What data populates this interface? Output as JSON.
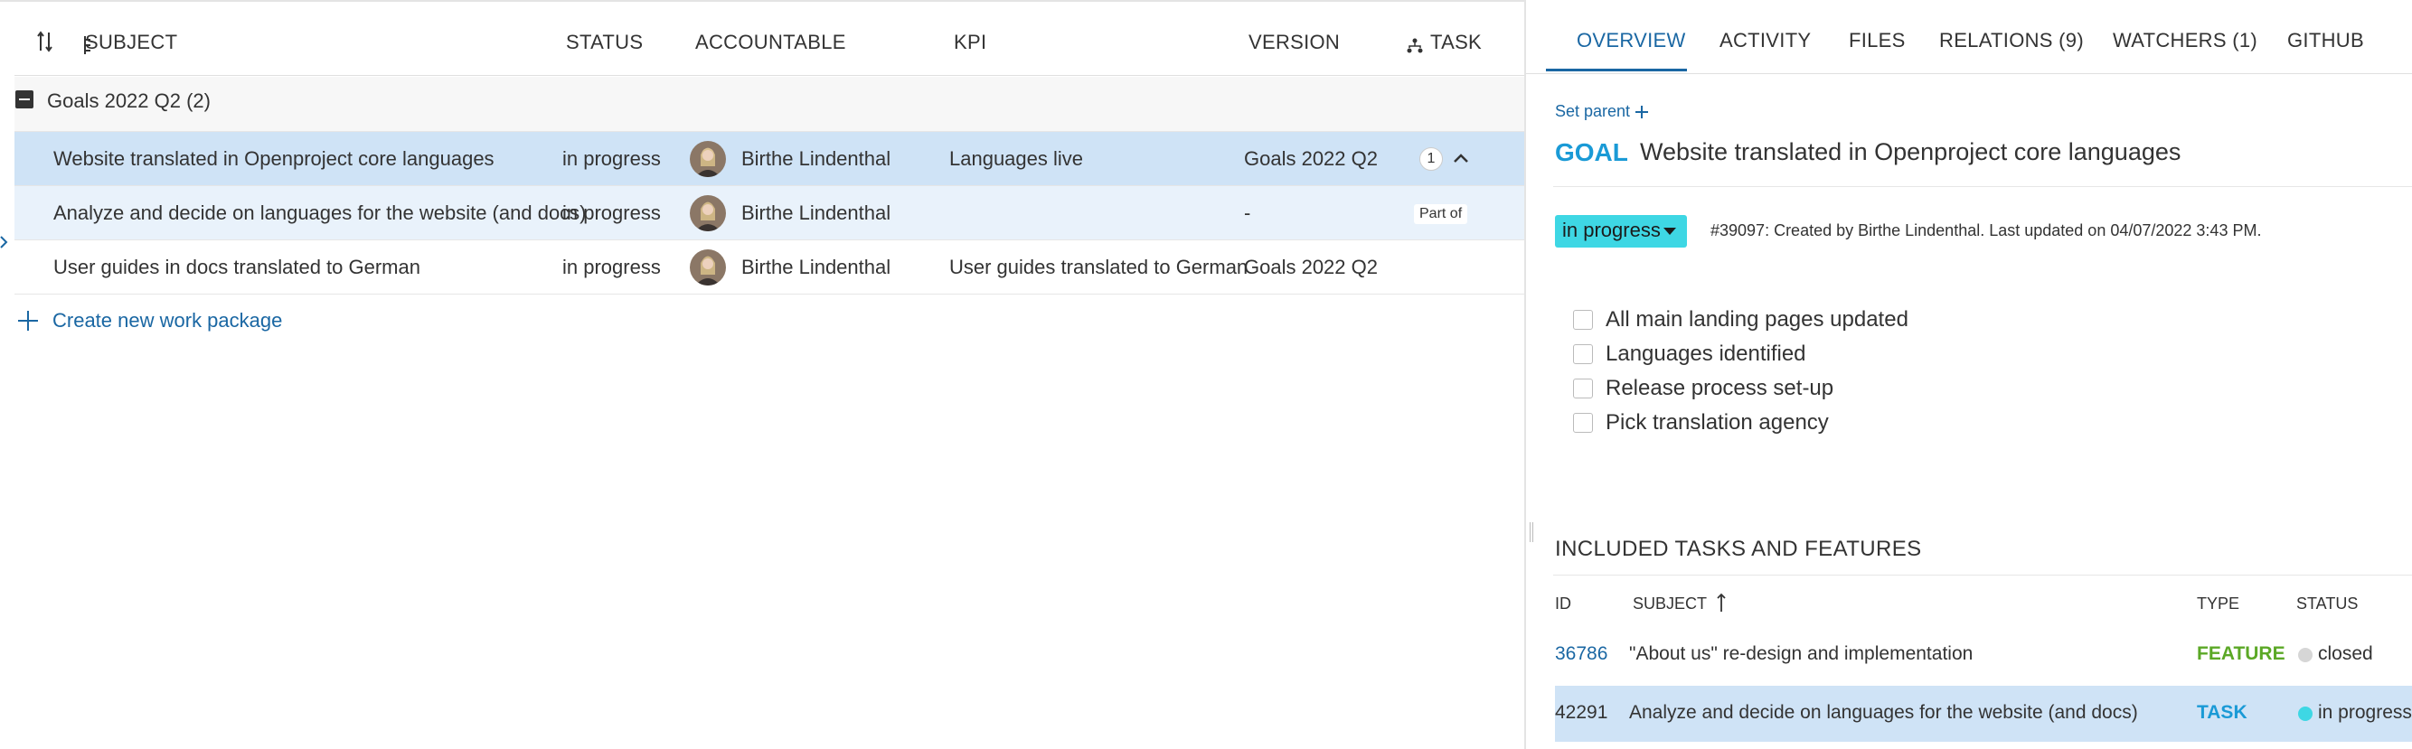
{
  "table": {
    "headers": {
      "subject": "SUBJECT",
      "status": "STATUS",
      "accountable": "ACCOUNTABLE",
      "kpi": "KPI",
      "version": "VERSION",
      "task": "TASK"
    },
    "group": {
      "label": "Goals 2022 Q2 (2)"
    },
    "rows": [
      {
        "subject": "Website translated in Openproject core languages",
        "status": "in progress",
        "accountable": "Birthe Lindenthal",
        "kpi": "Languages live",
        "version": "Goals 2022 Q2",
        "task_count": "1"
      },
      {
        "subject": "Analyze and decide on languages for the website (and docs)",
        "status": "in progress",
        "accountable": "Birthe Lindenthal",
        "kpi": "",
        "version": "-",
        "task_relation": "Part of"
      },
      {
        "subject": "User guides in docs translated to German",
        "status": "in progress",
        "accountable": "Birthe Lindenthal",
        "kpi": "User guides translated to German",
        "version": "Goals 2022 Q2"
      }
    ],
    "create_label": "Create new work package"
  },
  "details": {
    "tabs": [
      {
        "label": "OVERVIEW"
      },
      {
        "label": "ACTIVITY"
      },
      {
        "label": "FILES"
      },
      {
        "label": "RELATIONS (9)"
      },
      {
        "label": "WATCHERS (1)"
      },
      {
        "label": "GITHUB"
      }
    ],
    "set_parent": "Set parent",
    "type": "GOAL",
    "subject": "Website translated in Openproject core languages",
    "status": "in progress",
    "meta": "#39097: Created by Birthe Lindenthal. Last updated on 04/07/2022 3:43 PM.",
    "checklist": [
      "All main landing pages updated",
      "Languages identified",
      "Release process set-up",
      "Pick translation agency"
    ],
    "included": {
      "title": "INCLUDED TASKS AND FEATURES",
      "headers": {
        "id": "ID",
        "subject": "SUBJECT",
        "type": "TYPE",
        "status": "STATUS"
      },
      "rows": [
        {
          "id": "36786",
          "subject": "\"About us\" re-design and implementation",
          "type": "FEATURE",
          "status": "closed"
        },
        {
          "id": "42291",
          "subject": "Analyze and decide on languages for the website (and docs)",
          "type": "TASK",
          "status": "in progress"
        }
      ]
    }
  },
  "colors": {
    "link": "#1a67a3",
    "selected_row": "#cfe3f6",
    "status_in_progress": "#3ed7e4",
    "goal_type": "#1a9ad6",
    "feature_type": "#5ba826",
    "status_closed": "#d6d6d6"
  },
  "icons": [
    "sort-icon",
    "hierarchy-icon",
    "task-hierarchy-icon",
    "collapse-icon",
    "chevron-up-icon",
    "plus-icon",
    "caret-down-icon",
    "sort-ascending-icon"
  ]
}
